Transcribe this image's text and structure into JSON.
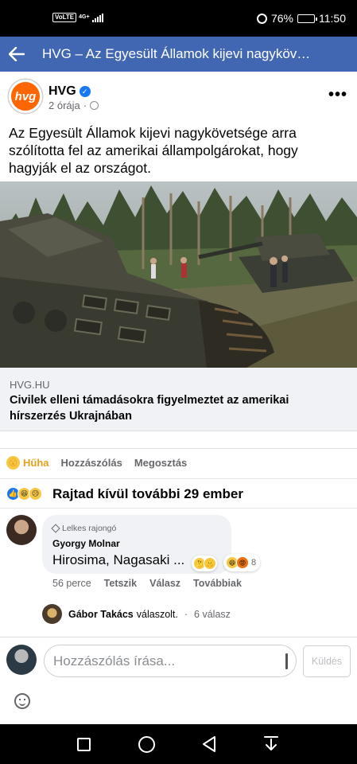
{
  "status_bar": {
    "volte": "VoLTE",
    "network": "4G+",
    "battery": "76%",
    "battery_fraction": 0.76,
    "time": "11:50"
  },
  "app_bar": {
    "title": "HVG – Az Egyesült Államok kijevi nagyköv…"
  },
  "post": {
    "page_name": "HVG",
    "logo_text": "hvg",
    "time": "2 órája",
    "separator": "·",
    "text": "Az Egyesült Államok kijevi nagykövetsége arra szólította fel az amerikai állampolgárokat, hogy hagyják el az országot.",
    "link": {
      "domain": "HVG.HU",
      "title": "Civilek elleni támadásokra figyelmeztet az amerikai hírszerzés Ukrajnában"
    }
  },
  "actions": {
    "react": "Hűha",
    "comment": "Hozzászólás",
    "share": "Megosztás"
  },
  "reactions_summary": "Rajtad kívül további 29 ember",
  "comment": {
    "badge": "Lelkes rajongó",
    "author": "Gyorgy Molnar",
    "text": "Hirosima, Nagasaki ...",
    "reaction_count": "8",
    "age": "56 perce",
    "like": "Tetszik",
    "reply": "Válasz",
    "more": "Továbbiak"
  },
  "reply_preview": {
    "name": "Gábor Takács",
    "action": "válaszolt.",
    "separator": "·",
    "count": "6 válasz"
  },
  "composer": {
    "placeholder": "Hozzászólás írása...",
    "send": "Küldés"
  },
  "colors": {
    "brand_bar": "#4267b2",
    "hvg_orange": "#ff6600",
    "wow_yellow": "#e7a11c"
  }
}
